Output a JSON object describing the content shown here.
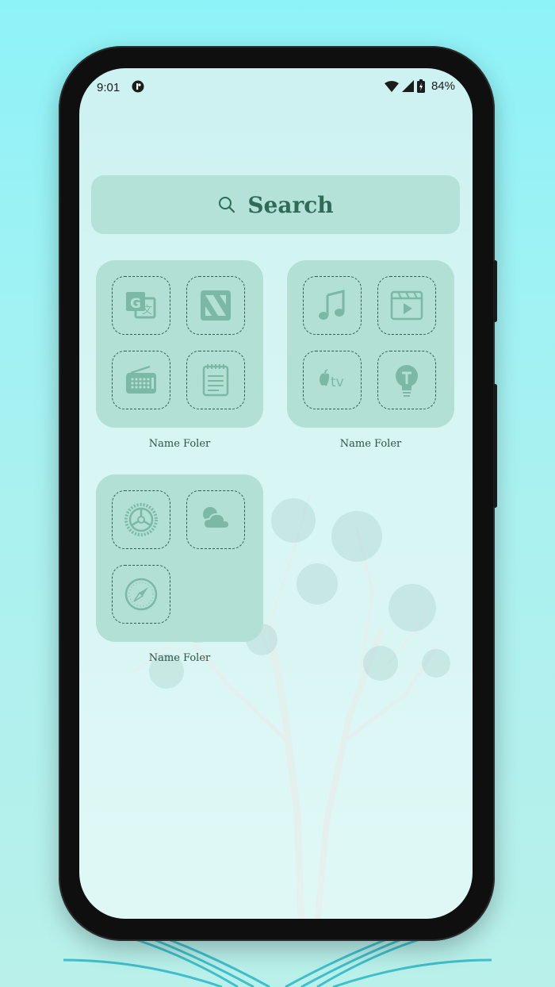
{
  "status_bar": {
    "time": "9:01",
    "battery": "84%",
    "icons": [
      "app-notification-icon",
      "wifi-icon",
      "signal-icon",
      "battery-icon"
    ]
  },
  "search": {
    "label": "Search",
    "icon": "search-icon"
  },
  "folders": [
    {
      "name": "Name Foler",
      "apps": [
        "translate-icon",
        "news-icon",
        "radio-icon",
        "notes-icon"
      ]
    },
    {
      "name": "Name Foler",
      "apps": [
        "music-icon",
        "clips-icon",
        "apple-tv-icon",
        "tips-icon"
      ]
    },
    {
      "name": "Name Foler",
      "apps": [
        "settings-icon",
        "weather-icon",
        "safari-compass-icon"
      ]
    }
  ],
  "colors": {
    "accent": "#2f6b56",
    "folder_bg": "#b2e0d4",
    "search_bg": "#b4e2d9",
    "screen_bg": "#d6f5f3",
    "outer_bg": "#8ef3f8"
  }
}
